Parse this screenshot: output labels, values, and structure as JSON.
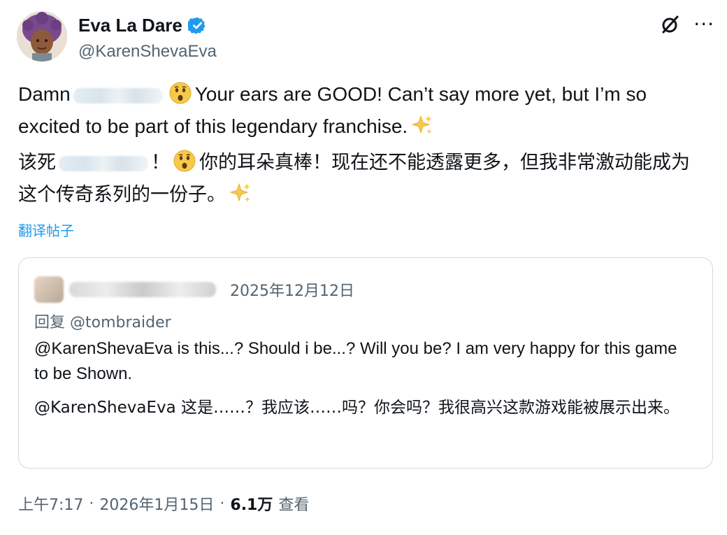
{
  "post": {
    "author": {
      "display_name": "Eva La Dare",
      "handle": "@KarenShevaEva",
      "verified": true
    },
    "text_en": {
      "prefix": "Damn",
      "suffix": "Your ears are GOOD! Can’t say more yet, but I’m so excited to be part of this legendary franchise."
    },
    "text_zh": {
      "prefix": "该死",
      "middle": "！",
      "suffix": "你的耳朵真棒！现在还不能透露更多，但我非常激动能成为这个传奇系列的一份子。"
    },
    "translate_label": "翻译帖子",
    "time": "上午7:17",
    "date": "2026年1月15日",
    "views_count": "6.1万",
    "views_label": "查看"
  },
  "quoted_post": {
    "date": "2025年12月12日",
    "reply_to": "回复 @tombraider",
    "text_en": "@KarenShevaEva is this...? Should i be...? Will you be? I am very happy for this game to be Shown.",
    "text_zh": "@KarenShevaEva 这是……？我应该……吗？你会吗？我很高兴这款游戏能被展示出来。"
  },
  "icons": {
    "verified": "verified-badge-icon",
    "grok": "grok-icon",
    "more": "more-icon",
    "wow": "astonished-face-emoji-icon",
    "sparkles": "sparkles-emoji-icon"
  },
  "colors": {
    "accent": "#1d9bf0",
    "secondary_text": "#536471",
    "primary_text": "#0f1419",
    "border": "#cfd9de",
    "emoji_yellow": "#f7c948"
  }
}
